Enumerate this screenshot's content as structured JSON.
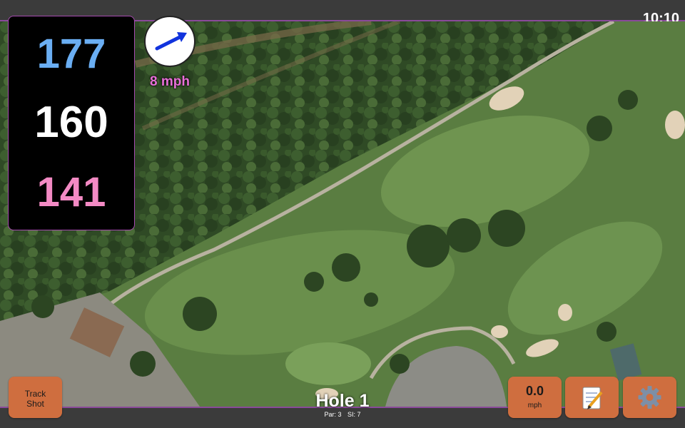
{
  "status": {
    "time": "10:10"
  },
  "distances": {
    "back": "177",
    "middle": "160",
    "front": "141"
  },
  "wind": {
    "speed": "8 mph",
    "direction_icon": "arrow-right-icon"
  },
  "hole": {
    "title": "Hole 1",
    "par": "Par: 3",
    "si": "SI: 7"
  },
  "buttons": {
    "track_line1": "Track",
    "track_line2": "Shot",
    "speed_value": "0.0",
    "speed_unit": "mph",
    "notes_icon": "notepad-icon",
    "settings_icon": "gear-icon"
  },
  "colors": {
    "accent": "#a64bb0",
    "back_distance": "#6aaef3",
    "middle_distance": "#ffffff",
    "front_distance": "#f38ac4",
    "button": "#cf6e3f"
  }
}
